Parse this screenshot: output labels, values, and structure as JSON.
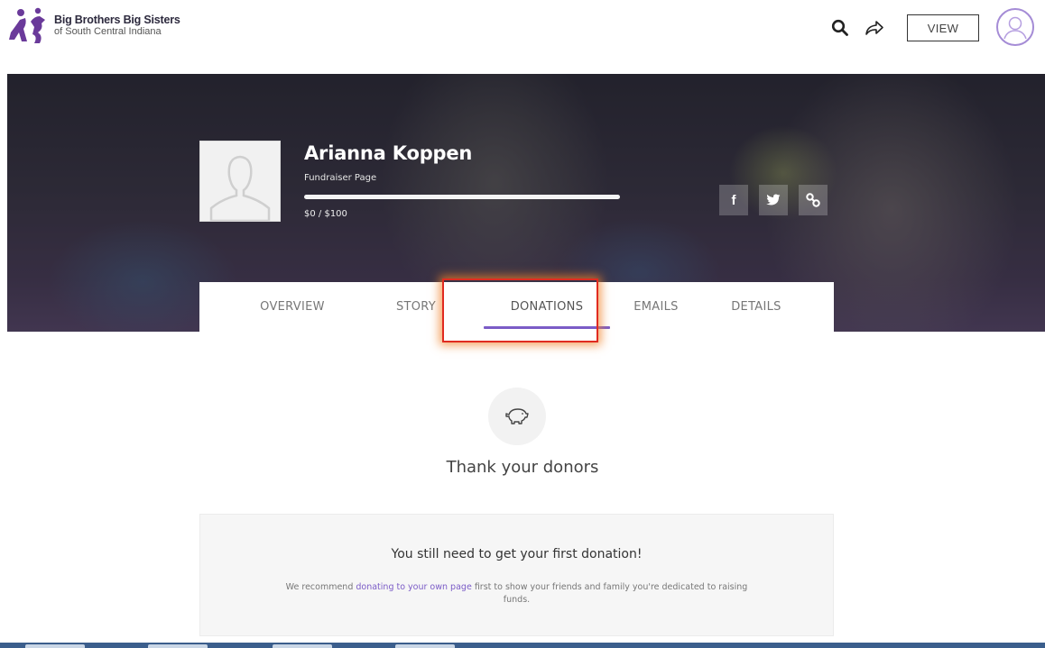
{
  "header": {
    "logo_title": "Big Brothers Big Sisters",
    "logo_subtitle": "of South Central Indiana",
    "view_label": "VIEW",
    "icons": [
      "search-icon",
      "share-icon",
      "user-avatar-icon"
    ]
  },
  "profile": {
    "name": "Arianna Koppen",
    "page_type": "Fundraiser Page",
    "raised": "$0",
    "goal": "$100",
    "amount_text": "$0 / $100",
    "progress_fraction": 0.0
  },
  "share": {
    "facebook_label": "f",
    "icons": [
      "facebook-icon",
      "twitter-icon",
      "link-icon"
    ]
  },
  "tabs": [
    {
      "label": "OVERVIEW",
      "active": false
    },
    {
      "label": "STORY",
      "active": false
    },
    {
      "label": "DONATIONS",
      "active": true
    },
    {
      "label": "EMAILS",
      "active": false
    },
    {
      "label": "DETAILS",
      "active": false
    }
  ],
  "content": {
    "heading": "Thank your donors",
    "empty_title": "You still need to get your first donation!",
    "desc_prefix": "We recommend ",
    "desc_link": "donating to your own page",
    "desc_suffix": " first to show your friends and family you're dedicated to raising funds."
  },
  "colors": {
    "accent": "#7b5cc7",
    "highlight": "#e02b20"
  }
}
